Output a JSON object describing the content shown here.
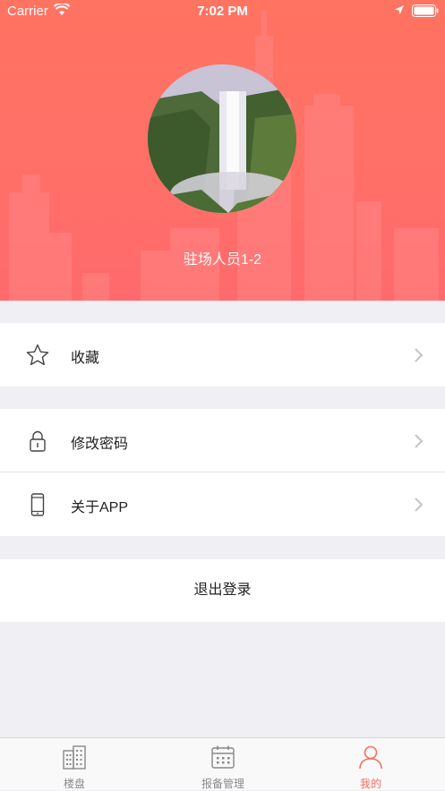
{
  "status_bar": {
    "carrier": "Carrier",
    "time": "7:02 PM"
  },
  "profile": {
    "name": "驻场人员1-2",
    "avatar_icon": "waterfall-avatar-image"
  },
  "menu": {
    "favorites": {
      "label": "收藏",
      "icon": "star-icon"
    },
    "change_password": {
      "label": "修改密码",
      "icon": "lock-icon"
    },
    "about": {
      "label": "关于APP",
      "icon": "phone-icon"
    }
  },
  "logout_label": "退出登录",
  "tabs": [
    {
      "label": "楼盘",
      "icon": "building-icon"
    },
    {
      "label": "报备管理",
      "icon": "calendar-icon"
    },
    {
      "label": "我的",
      "icon": "person-icon",
      "active": true
    }
  ],
  "colors": {
    "accent": "#ff6b5f",
    "header": "#ff6f68",
    "background": "#efeff4"
  }
}
